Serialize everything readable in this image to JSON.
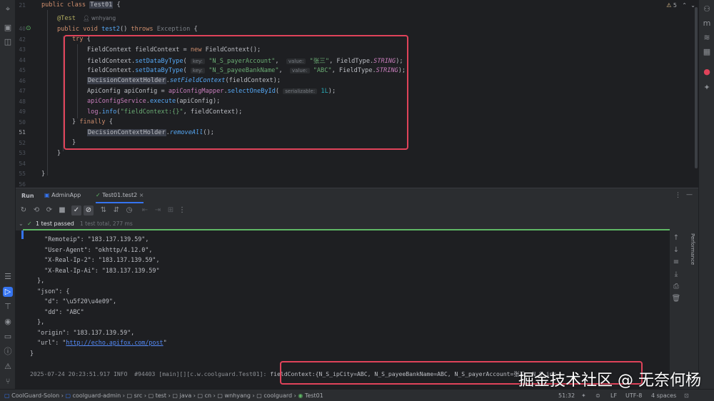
{
  "editor": {
    "line_numbers": [
      "21",
      "",
      "40",
      "41",
      "42",
      "43",
      "44",
      "45",
      "46",
      "47",
      "48",
      "49",
      "50",
      "51",
      "52",
      "53",
      "54",
      "55",
      "56"
    ],
    "lines": {
      "l21_kw": "public class ",
      "l21_cls": "Test01",
      "l21_brace": " {",
      "annotation": "@Test",
      "author": "wnhyang",
      "l41_kw": "public void ",
      "l41_fn": "test2",
      "l41_rest": "() ",
      "l41_throws": "throws ",
      "l41_exc": "Exception",
      "l41_brace": " {",
      "l42_try": "try",
      "l42_brace": " {",
      "l43_a": "FieldContext fieldContext = ",
      "l43_new": "new",
      "l43_b": " FieldContext();",
      "l44_a": "fieldContext.",
      "l44_fn": "setDataByType",
      "l44_paren": "( ",
      "l44_hint_key": "key:",
      "l44_key": "\"N_S_payerAccount\"",
      "l44_comma": ",  ",
      "l44_hint_value": "value:",
      "l44_value": "\"张三\"",
      "l44_c2": ", FieldType.",
      "l44_const": "STRING",
      "l44_end": ");",
      "l45_a": "fieldContext.",
      "l45_fn": "setDataByType",
      "l45_paren": "( ",
      "l45_hint_key": "key:",
      "l45_key": "\"N_S_payeeBankName\"",
      "l45_comma": ",  ",
      "l45_hint_value": "value:",
      "l45_value": "\"ABC\"",
      "l45_c2": ", FieldType.",
      "l45_const": "STRING",
      "l45_end": ");",
      "l46_cls": "DecisionContextHolder",
      "l46_dot": ".",
      "l46_fn": "setFieldContext",
      "l46_end": "(fieldContext);",
      "l47_a": "ApiConfig apiConfig = ",
      "l47_field": "apiConfigMapper",
      "l47_dot": ".",
      "l47_fn": "selectOneById",
      "l47_paren": "( ",
      "l47_hint": "serializable:",
      "l47_num": "1L",
      "l47_end": ");",
      "l48_field": "apiConfigService",
      "l48_dot": ".",
      "l48_fn": "execute",
      "l48_end": "(apiConfig);",
      "l49_field": "log",
      "l49_dot": ".",
      "l49_fn": "info",
      "l49_paren": "(",
      "l49_str": "\"fieldContext:{}\"",
      "l49_end": ", fieldContext);",
      "l50_close": "} ",
      "l50_finally": "finally",
      "l50_brace": " {",
      "l51_cls": "DecisionContextHolder",
      "l51_dot": ".",
      "l51_fn": "removeAll",
      "l51_end": "();",
      "l52": "}",
      "l53": "}",
      "l55": "}"
    },
    "warnings_count": "5"
  },
  "run_panel": {
    "title": "Run",
    "tabs": [
      {
        "label": "AdminApp"
      },
      {
        "label": "Test01.test2"
      }
    ],
    "status_text": "1 test passed",
    "status_detail": "1 test total, 277 ms",
    "performance_label": "Performance",
    "console_lines": [
      "    \"Remoteip\": \"183.137.139.59\",",
      "    \"User-Agent\": \"okhttp/4.12.0\",",
      "    \"X-Real-Ip-2\": \"183.137.139.59\",",
      "    \"X-Real-Ip-Ai\": \"183.137.139.59\"",
      "  },",
      "  \"json\": {",
      "    \"d\": \"\\u5f20\\u4e09\",",
      "    \"dd\": \"ABC\"",
      "  },",
      "  \"origin\": \"183.137.139.59\",",
      "  \"url\": \"",
      "}"
    ],
    "url_link": "http://echo.apifox.com/post",
    "url_tail": "\"",
    "log_line_prefix": "2025-07-24 20:23:51.917 INFO  #94403 [main][][c.w.coolguard.Test01]: ",
    "log_line_msg": "fieldContext:{N_S_ipCity=ABC, N_S_payeeBankName=ABC, N_S_payerAccount=张三, N_S_inc"
  },
  "status_bar": {
    "breadcrumbs": [
      "CoolGuard-Solon",
      "coolguard-admin",
      "src",
      "test",
      "java",
      "cn",
      "wnhyang",
      "coolguard",
      "Test01"
    ],
    "position": "51:32",
    "line_ending": "LF",
    "encoding": "UTF-8",
    "indent": "4 spaces"
  },
  "watermark": "掘金技术社区 @ 无奈何杨",
  "colors": {
    "accent": "#3574f0",
    "annotation_box": "#e0435a",
    "keyword": "#cf8e6d",
    "string": "#6aab73",
    "function": "#56a8f5",
    "pass_green": "#5fb865"
  }
}
